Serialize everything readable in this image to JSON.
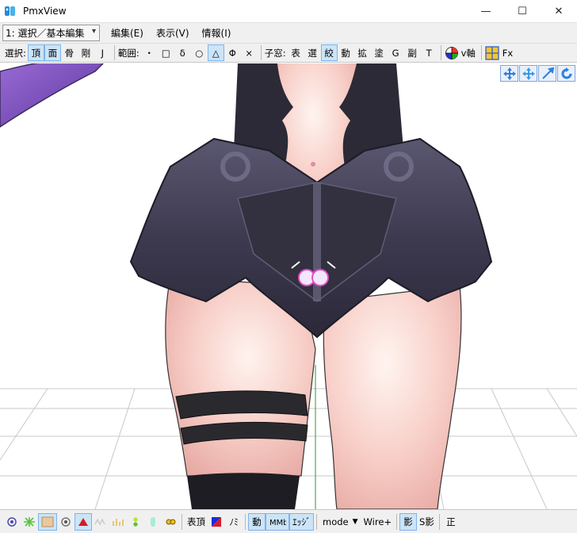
{
  "window": {
    "title": "PmxView",
    "minimize": "—",
    "maximize": "☐",
    "close": "✕"
  },
  "menubar": {
    "mode_select": "1: 選択／基本編集",
    "items": [
      "編集(E)",
      "表示(V)",
      "情報(I)"
    ]
  },
  "toolstrip": {
    "select_label": "選択:",
    "select_buttons": [
      "頂",
      "面",
      "骨",
      "剛",
      "J"
    ],
    "range_label": "範囲:",
    "range_buttons": [
      "・",
      "□",
      "δ",
      "○",
      "△",
      "Φ",
      "×"
    ],
    "child_label": "子窓:",
    "child_buttons": [
      "表",
      "選",
      "絞",
      "動",
      "拡",
      "塗",
      "G",
      "副",
      "T"
    ],
    "axis_label": "v軸",
    "fx_label": "Fx"
  },
  "bottombar": {
    "vertex_label": "表頂",
    "no_label": "ﾉﾐ",
    "move_label": "動",
    "edge_label": "ｴｯｼﾞ",
    "mode_label": "mode",
    "wire_label": "Wire+",
    "shadow_label": "影",
    "sshadow_label": "S影",
    "front_label": "正"
  },
  "colors": {
    "accent": "#cce4f7",
    "accent_border": "#7eb4ea",
    "bar": "#f0f0f0"
  }
}
